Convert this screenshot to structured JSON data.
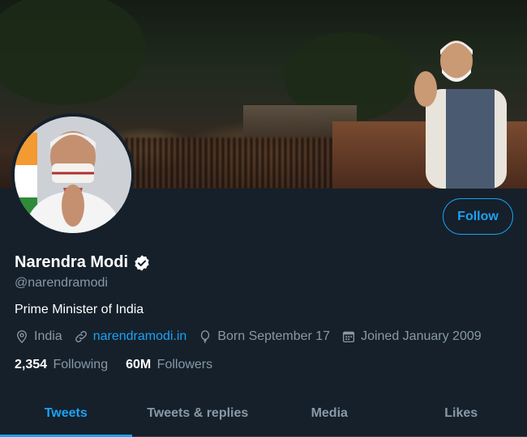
{
  "profile": {
    "name": "Narendra Modi",
    "handle": "@narendramodi",
    "bio": "Prime Minister of India",
    "verified": true,
    "follow_label": "Follow",
    "location": "India",
    "website": "narendramodi.in",
    "birthday": "Born September 17",
    "joined": "Joined January 2009",
    "following_count": "2,354",
    "following_label": "Following",
    "followers_count": "60M",
    "followers_label": "Followers"
  },
  "tabs": [
    {
      "label": "Tweets",
      "active": true
    },
    {
      "label": "Tweets & replies",
      "active": false
    },
    {
      "label": "Media",
      "active": false
    },
    {
      "label": "Likes",
      "active": false
    }
  ],
  "colors": {
    "background": "#15202b",
    "accent": "#1da1f2",
    "secondary_text": "#8899a6"
  },
  "icons": [
    "location-pin-icon",
    "link-icon",
    "balloon-icon",
    "calendar-icon",
    "verified-badge-icon"
  ]
}
